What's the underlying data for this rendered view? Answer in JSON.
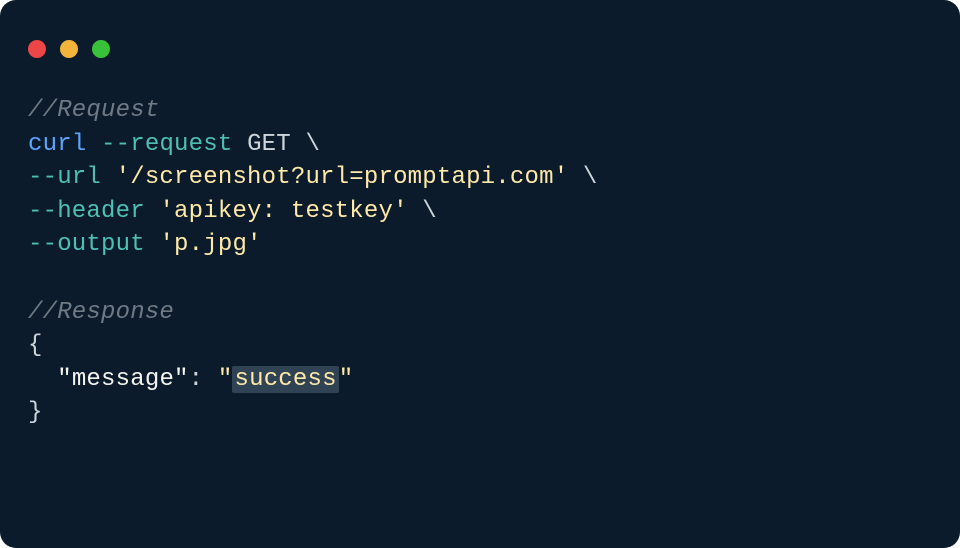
{
  "window": {
    "dots": [
      "red",
      "yellow",
      "green"
    ]
  },
  "code": {
    "request_comment": "//Request",
    "line1": {
      "cmd": "curl",
      "flag": "--request",
      "method": "GET",
      "cont": "\\"
    },
    "line2": {
      "flag": "--url",
      "string": "'/screenshot?url=promptapi.com'",
      "cont": "\\"
    },
    "line3": {
      "flag": "--header",
      "string": "'apikey: testkey'",
      "cont": "\\"
    },
    "line4": {
      "flag": "--output",
      "string": "'p.jpg'"
    },
    "response_comment": "//Response",
    "json_open": "{",
    "json_key_quote_open": "\"",
    "json_key": "message",
    "json_key_quote_close": "\"",
    "json_colon": ": ",
    "json_val_quote_open": "\"",
    "json_val": "success",
    "json_val_quote_close": "\"",
    "json_close": "}"
  }
}
